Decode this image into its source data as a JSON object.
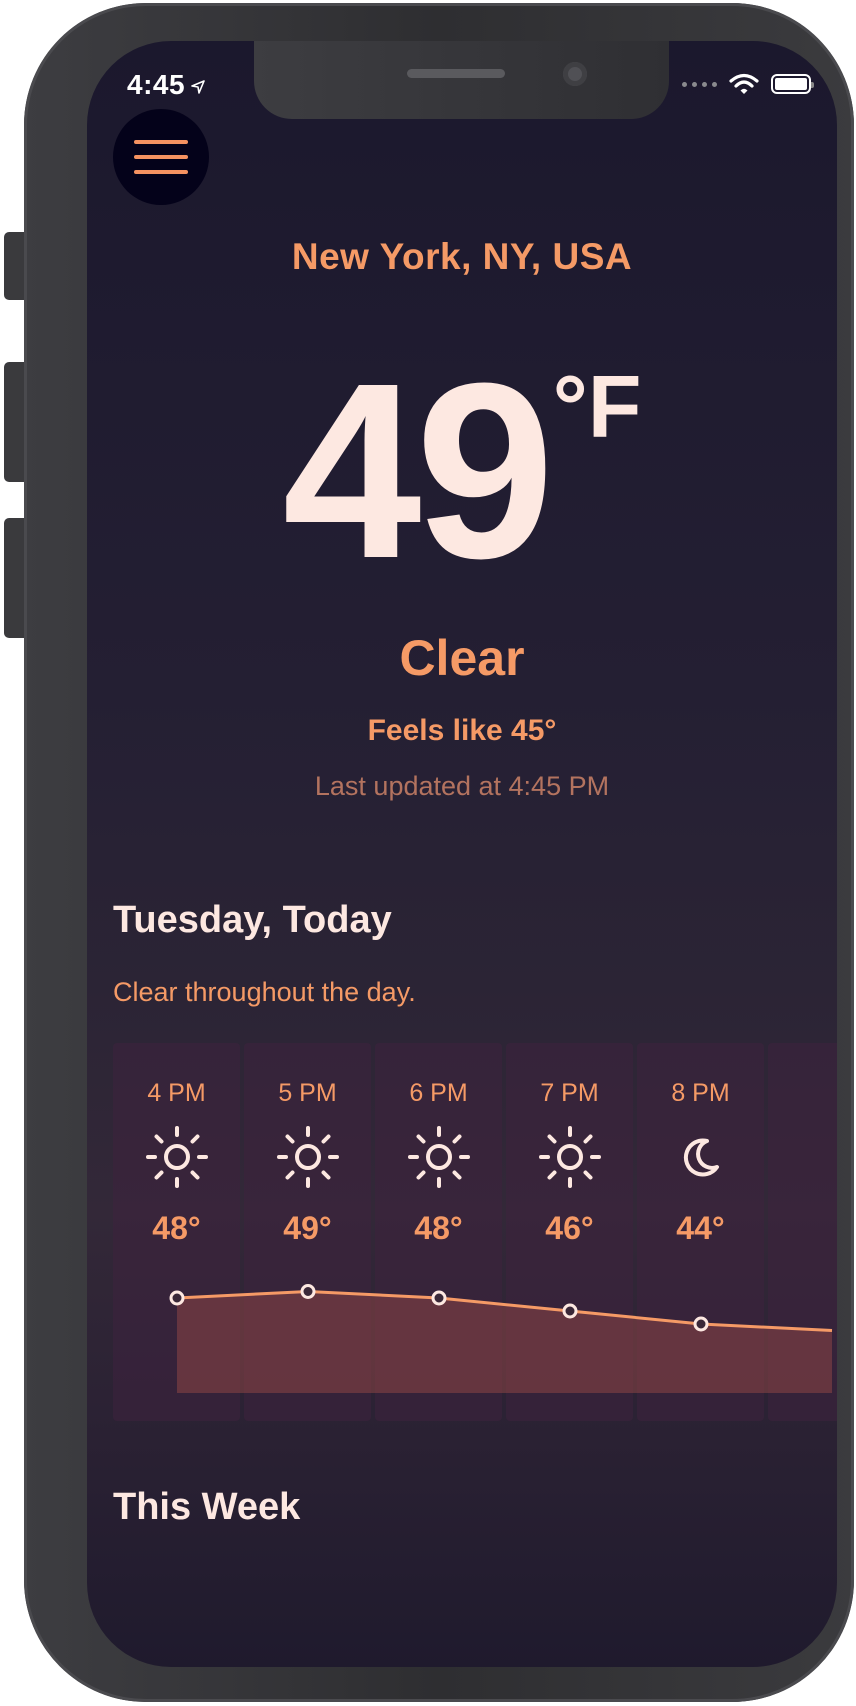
{
  "status_bar": {
    "time": "4:45",
    "icons": [
      "location-arrow-icon",
      "signal-dots-icon",
      "wifi-icon",
      "battery-icon"
    ]
  },
  "menu": {
    "icon": "hamburger-menu-icon"
  },
  "location": "New York, NY, USA",
  "current": {
    "temperature": "49",
    "unit": "°F",
    "condition": "Clear",
    "feels_like": "Feels like 45°",
    "last_updated": "Last updated at 4:45 PM"
  },
  "today": {
    "title": "Tuesday, Today",
    "description": "Clear throughout the day."
  },
  "hourly": [
    {
      "time": "4 PM",
      "icon": "sun-icon",
      "temp": "48°"
    },
    {
      "time": "5 PM",
      "icon": "sun-icon",
      "temp": "49°"
    },
    {
      "time": "6 PM",
      "icon": "sun-icon",
      "temp": "48°"
    },
    {
      "time": "7 PM",
      "icon": "sun-icon",
      "temp": "46°"
    },
    {
      "time": "8 PM",
      "icon": "moon-icon",
      "temp": "44°"
    }
  ],
  "hourly_temps": [
    48,
    49,
    48,
    46,
    44,
    43
  ],
  "week": {
    "title": "This Week"
  },
  "colors": {
    "accent": "#f59a66",
    "primary_text": "#fde8e1",
    "background": "#1b182d"
  }
}
